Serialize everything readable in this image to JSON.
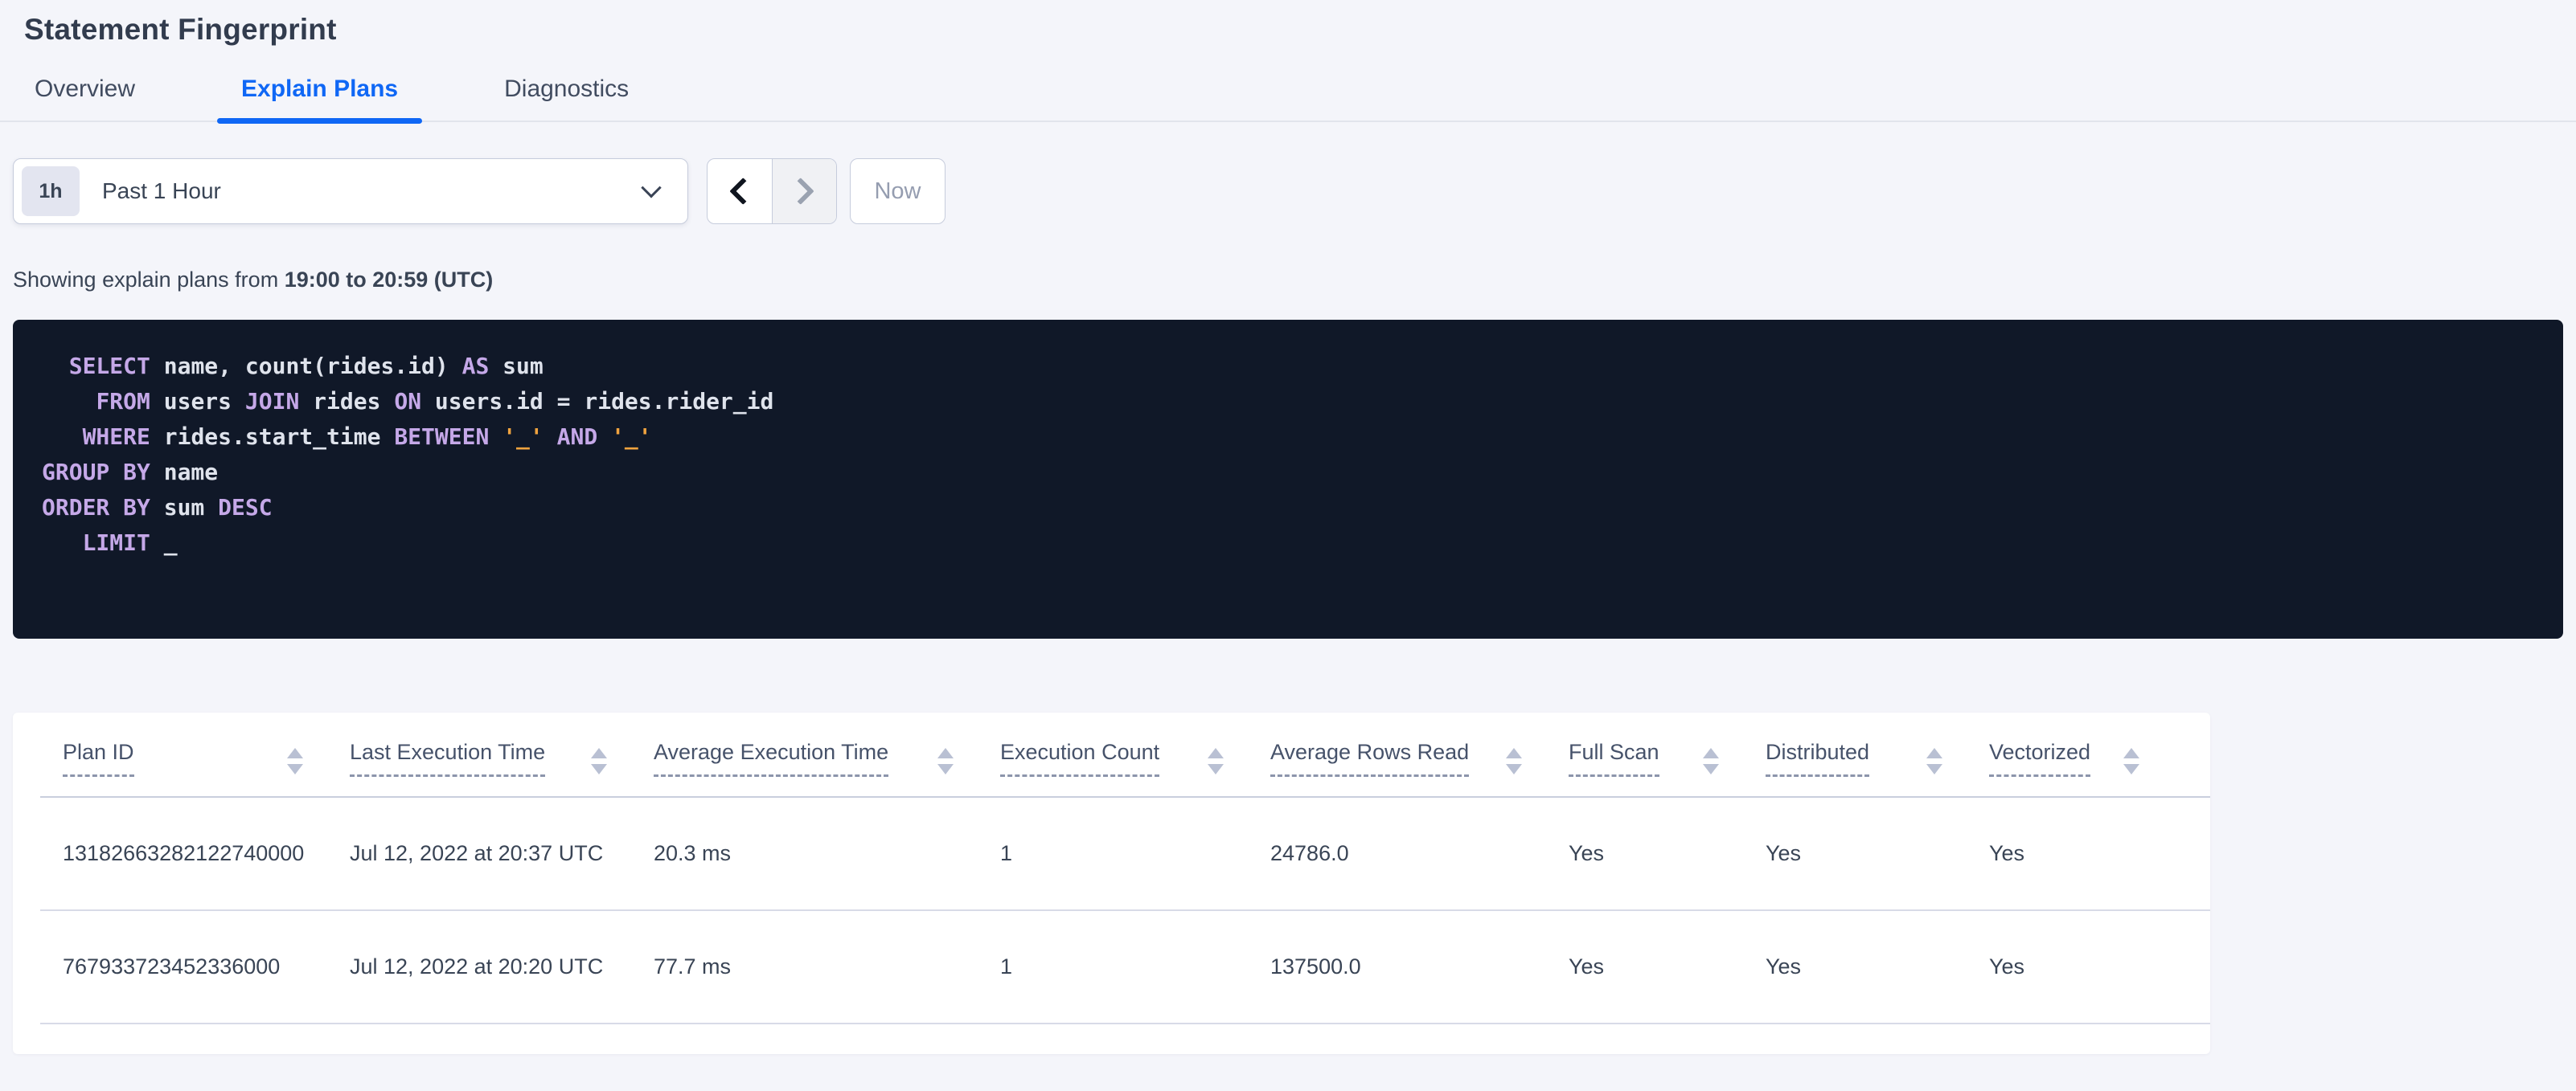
{
  "page_title": "Statement Fingerprint",
  "tabs": [
    {
      "label": "Overview",
      "active": false
    },
    {
      "label": "Explain Plans",
      "active": true
    },
    {
      "label": "Diagnostics",
      "active": false
    }
  ],
  "time_picker": {
    "shortcut_badge": "1h",
    "selected_range": "Past 1 Hour",
    "chevron_icon": "chevron-down-icon"
  },
  "pager": {
    "prev_icon": "chevron-left-icon",
    "next_icon": "chevron-right-icon",
    "now_label": "Now"
  },
  "summary": {
    "prefix": "Showing explain plans from ",
    "bold_range": "19:00 to 20:59 (UTC)"
  },
  "sql_editor": {
    "lines": [
      [
        {
          "c": "pl",
          "t": "  "
        },
        {
          "c": "kw",
          "t": "SELECT"
        },
        {
          "c": "pl",
          "t": " name, count(rides.id) "
        },
        {
          "c": "kw",
          "t": "AS"
        },
        {
          "c": "pl",
          "t": " sum"
        }
      ],
      [
        {
          "c": "pl",
          "t": "    "
        },
        {
          "c": "kw",
          "t": "FROM"
        },
        {
          "c": "pl",
          "t": " users "
        },
        {
          "c": "kw",
          "t": "JOIN"
        },
        {
          "c": "pl",
          "t": " rides "
        },
        {
          "c": "kw",
          "t": "ON"
        },
        {
          "c": "pl",
          "t": " users.id = rides.rider_id"
        }
      ],
      [
        {
          "c": "pl",
          "t": "   "
        },
        {
          "c": "kw",
          "t": "WHERE"
        },
        {
          "c": "pl",
          "t": " rides.start_time "
        },
        {
          "c": "kw",
          "t": "BETWEEN"
        },
        {
          "c": "pl",
          "t": " "
        },
        {
          "c": "str",
          "t": "'_'"
        },
        {
          "c": "pl",
          "t": " "
        },
        {
          "c": "kw",
          "t": "AND"
        },
        {
          "c": "pl",
          "t": " "
        },
        {
          "c": "str",
          "t": "'_'"
        }
      ],
      [
        {
          "c": "kw",
          "t": "GROUP BY"
        },
        {
          "c": "pl",
          "t": " name"
        }
      ],
      [
        {
          "c": "kw",
          "t": "ORDER BY"
        },
        {
          "c": "pl",
          "t": " sum "
        },
        {
          "c": "kw",
          "t": "DESC"
        }
      ],
      [
        {
          "c": "pl",
          "t": "   "
        },
        {
          "c": "kw",
          "t": "LIMIT"
        },
        {
          "c": "pl",
          "t": " _"
        }
      ]
    ]
  },
  "plans_table": {
    "columns": [
      "Plan ID",
      "Last Execution Time",
      "Average Execution Time",
      "Execution Count",
      "Average Rows Read",
      "Full Scan",
      "Distributed",
      "Vectorized"
    ],
    "rows": [
      [
        "13182663282122740000",
        "Jul 12, 2022 at 20:37 UTC",
        "20.3 ms",
        "1",
        "24786.0",
        "Yes",
        "Yes",
        "Yes"
      ],
      [
        "767933723452336000",
        "Jul 12, 2022 at 20:20 UTC",
        "77.7 ms",
        "1",
        "137500.0",
        "Yes",
        "Yes",
        "Yes"
      ]
    ]
  },
  "colors": {
    "accent_blue": "#0f67f5",
    "code_background": "#101828",
    "code_keyword": "#c5a8e8",
    "code_string": "#f0a33f",
    "code_plain": "#dfe3ec"
  }
}
